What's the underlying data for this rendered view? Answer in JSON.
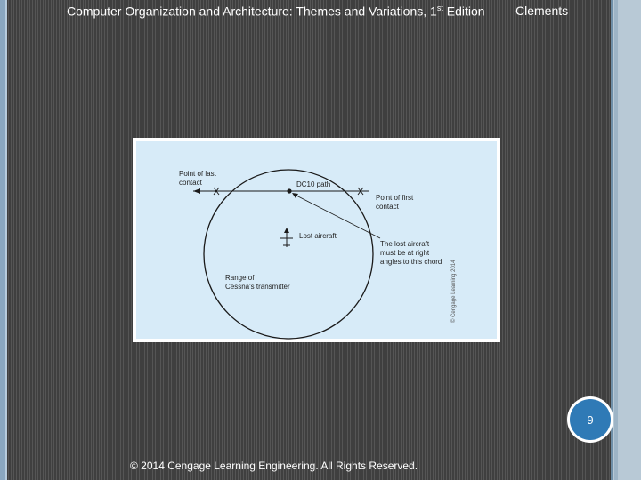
{
  "header": {
    "book_title_main": "Computer Organization and Architecture: Themes and Variations, 1",
    "book_title_sup": "st",
    "book_title_end": " Edition",
    "author": "Clements"
  },
  "figure": {
    "labels": {
      "last_contact_line1": "Point of last",
      "last_contact_line2": "contact",
      "dc10_path": "DC10 path",
      "first_contact_line1": "Point of first",
      "first_contact_line2": "contact",
      "lost_aircraft": "Lost aircraft",
      "right_angle_line1": "The lost aircraft",
      "right_angle_line2": "must be at right",
      "right_angle_line3": "angles to this chord",
      "range_line1": "Range of",
      "range_line2": "Cessna's transmitter",
      "credit": "© Cengage Learning 2014"
    }
  },
  "page_number": "9",
  "footer": {
    "copyright": "© 2014 Cengage Learning Engineering. All Rights Reserved."
  },
  "colors": {
    "figure_background": "#d7ebf8",
    "badge": "#2f7ab6"
  }
}
